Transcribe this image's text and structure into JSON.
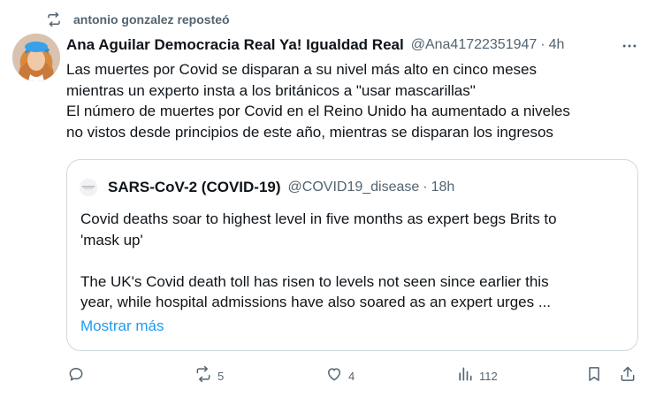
{
  "repost": {
    "text": "antonio gonzalez reposteó",
    "icon": "repost-icon"
  },
  "tweet": {
    "author_name": "Ana Aguilar Democracia Real Ya! Igualdad Real",
    "handle": "@Ana41722351947",
    "separator": "·",
    "time": "4h",
    "lines": [
      "Las muertes por Covid se disparan a su nivel más alto en cinco meses",
      "mientras un experto insta a los británicos a \"usar mascarillas\"",
      "El número de muertes por Covid en el Reino Unido ha aumentado a niveles",
      "no vistos desde principios de este año, mientras se disparan los ingresos"
    ]
  },
  "quote": {
    "author_name": "SARS-CoV-2 (COVID-19)",
    "handle": "@COVID19_disease",
    "separator": "·",
    "time": "18h",
    "lines_p1": [
      "Covid deaths soar to highest level in five months as expert begs Brits to",
      "'mask up'"
    ],
    "lines_p2": [
      "The UK's Covid death toll has risen to levels not seen since earlier this",
      "year, while hospital admissions have also soared as an expert urges ..."
    ],
    "show_more": "Mostrar más"
  },
  "actions": {
    "reply": {
      "count": ""
    },
    "repost": {
      "count": "5"
    },
    "like": {
      "count": "4"
    },
    "views": {
      "count": "112"
    },
    "bookmark": {
      "count": ""
    },
    "share": {
      "count": ""
    }
  },
  "colors": {
    "text": "#0f1419",
    "secondary": "#536471",
    "link": "#1d9bf0",
    "border": "#cfd9de"
  }
}
